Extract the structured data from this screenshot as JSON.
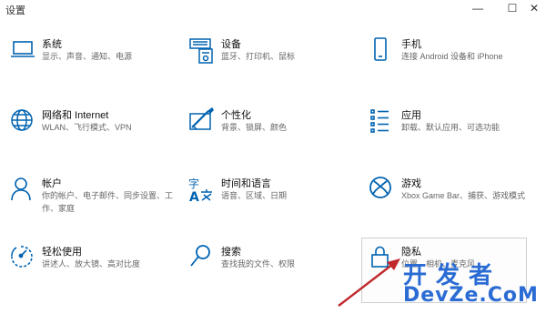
{
  "window": {
    "title": "设置",
    "minimize_glyph": "—",
    "maximize_glyph": "☐",
    "close_glyph": "✕"
  },
  "tiles": [
    {
      "key": "system",
      "name": "系统",
      "desc": "显示、声音、通知、电源",
      "icon": "laptop-icon"
    },
    {
      "key": "devices",
      "name": "设备",
      "desc": "蓝牙、打印机、鼠标",
      "icon": "keyboard-printer-icon"
    },
    {
      "key": "phone",
      "name": "手机",
      "desc": "连接 Android 设备和 iPhone",
      "icon": "phone-icon"
    },
    {
      "key": "network",
      "name": "网络和 Internet",
      "desc": "WLAN、飞行模式、VPN",
      "icon": "globe-icon"
    },
    {
      "key": "personalization",
      "name": "个性化",
      "desc": "背景、锁屏、颜色",
      "icon": "paint-brush-icon"
    },
    {
      "key": "apps",
      "name": "应用",
      "desc": "卸载、默认应用、可选功能",
      "icon": "apps-list-icon"
    },
    {
      "key": "accounts",
      "name": "帐户",
      "desc": "你的帐户、电子邮件、同步设置、工作、家庭",
      "icon": "person-icon"
    },
    {
      "key": "time-language",
      "name": "时间和语言",
      "desc": "语音、区域、日期",
      "icon": "language-icon"
    },
    {
      "key": "gaming",
      "name": "游戏",
      "desc": "Xbox Game Bar、捕获、游戏模式",
      "icon": "xbox-icon"
    },
    {
      "key": "ease-of-access",
      "name": "轻松使用",
      "desc": "讲述人、放大镜、高对比度",
      "icon": "ease-of-access-icon"
    },
    {
      "key": "search",
      "name": "搜索",
      "desc": "查找我的文件、权限",
      "icon": "search-icon"
    },
    {
      "key": "privacy",
      "name": "隐私",
      "desc": "位置、相机、麦克风",
      "icon": "lock-icon"
    }
  ],
  "watermark": {
    "line1": "开发者",
    "line2": "DevZe.CoM"
  },
  "colors": {
    "accent": "#0063b1",
    "arrow": "#c0282d",
    "watermark": "#2a6bd4"
  }
}
